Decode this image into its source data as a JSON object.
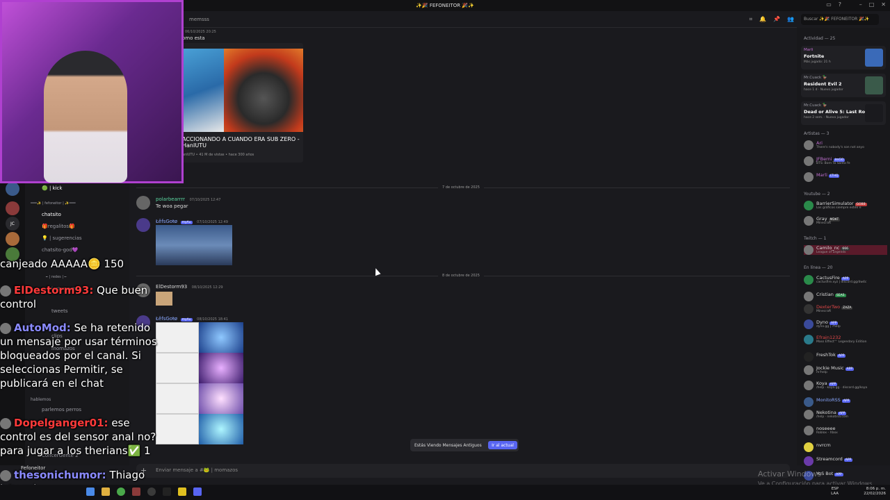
{
  "window": {
    "title": "✨🎉 FEFONEITOR 🎉✨"
  },
  "topbar": {
    "channel": "memsss",
    "search_placeholder": "Buscar ✨🎉 FEFONEITOR 🎉✨"
  },
  "messages": {
    "m0": {
      "time": "06/10/2025 20:25",
      "text": "omo esta"
    },
    "embed": {
      "title": "ACCIONANDO A CUANDO ERA SUB ZERO - HanIUTU",
      "sub": "anIUTU • 41 M de vistas • hace 300 años"
    },
    "div1": "7 de octubre de 2025",
    "m1": {
      "author": "polarbearrrr",
      "time": "07/10/2025 12:47",
      "text": "Te woa pegar"
    },
    "m2": {
      "author": "ŁêfsGoŧø",
      "badge": "myAu",
      "time": "07/10/2025 12:49"
    },
    "div2": "8 de octubre de 2025",
    "m3": {
      "author": "ElDestorm93",
      "time": "08/10/2025 12:29"
    },
    "m4": {
      "author": "ŁêfsGoŧø",
      "badge": "myAu",
      "time": "08/10/2025 18:41"
    }
  },
  "older_bar": {
    "text": "Estás Viendo Mensajes Antiguos",
    "button": "Ir al actual"
  },
  "composer": {
    "placeholder": "Enviar mensaje a #🐸 | momazos"
  },
  "channels": {
    "c1": "🟢 | kick",
    "c2": "═══✨ | fefoneitor | ✨═══",
    "c3": "chatsito",
    "c4": "🎁regalitos🎁",
    "c5": "💡 | sugerencias",
    "c6": "chatsito-god💜",
    "c7": "╾ | redes | ╾",
    "c8": "instagram",
    "c9": "tweets",
    "c10": "clips",
    "c11": "momazos",
    "c12": "hablemos",
    "c13": "parlemos perros",
    "c14": "ConcerGente 2",
    "user": "Fefoneitor"
  },
  "members": {
    "activity_header": "Actividad — 25",
    "act1": {
      "name": "Marli",
      "game": "Fortnite",
      "sub": "Más jugado: 21 h"
    },
    "act2": {
      "name": "Mr.Cuack 🦆",
      "game": "Resident Evil 2",
      "sub": "hace 1 d · Nuevo jugador"
    },
    "act3": {
      "name": "Mr.Cuack 🦆",
      "game": "Dead or Alive 5: Last Round",
      "sub": "hace 2 sem. · Nuevo jugador"
    },
    "artists_header": "Artistas — 3",
    "a1": {
      "name": "Ari",
      "sub": "There's nobody's son not anyo"
    },
    "a2": {
      "name": "JFBerni",
      "tag": "ImGO",
      "sub": "BTS: Born To Santa fe"
    },
    "a3": {
      "name": "Marli",
      "tag": "LTHQ"
    },
    "yt_header": "Youtube — 2",
    "y1": {
      "name": "BarrierSimulator",
      "tag": "GOBB",
      "sub": "Los gráficos siempre estén e"
    },
    "y2": {
      "name": "Gray",
      "tag": "MDKT",
      "sub": "Minecraft"
    },
    "tw_header": "Twitch — 1",
    "t1": {
      "name": "Camilo_nc",
      "tag": "666",
      "sub": "League of Legends"
    },
    "online_header": "En línea — 20",
    "o1": {
      "name": "CactusFire",
      "tag": "APP",
      "sub": "cactusfire.xyz | discord.gg/dw4c"
    },
    "o2": {
      "name": "Cristian",
      "tag": "SEAS"
    },
    "o3": {
      "name": "DexterTwo",
      "tag": "ZAZA",
      "sub": "Minecraft"
    },
    "o4": {
      "name": "Dyno",
      "tag": "APP",
      "sub": "dyno.gg | ?help"
    },
    "o5": {
      "name": "Efrain1232",
      "sub": "Mass Effect™ Legendary Edition"
    },
    "o6": {
      "name": "FreshTok",
      "tag": "APP"
    },
    "o7": {
      "name": "Jockie Music",
      "tag": "APP",
      "sub": "m!help"
    },
    "o8": {
      "name": "Koya",
      "tag": "APP",
      "sub": "/help · koya.gg · discord.gg/koya"
    },
    "o9": {
      "name": "MonitoRSS",
      "tag": "APP"
    },
    "o10": {
      "name": "Nekotina",
      "tag": "APP",
      "sub": "/help · nekotina.com"
    },
    "o11": {
      "name": "noseeee",
      "sub": "Roblox - Xbox"
    },
    "o12": {
      "name": "nvrcrn"
    },
    "o13": {
      "name": "Streamcord",
      "tag": "APP"
    },
    "o14": {
      "name": "YoS Bot",
      "tag": "APP"
    }
  },
  "overlay_chat": {
    "l1": "canjeado AAAAA🪙 150",
    "u2": "ElDestorm93:",
    "t2": "Que buen control",
    "u3": "AutoMod:",
    "t3": "Se ha retenido un mensaje por usar términos bloqueados por el canal. Si seleccionas Permitir, se publicará en el chat",
    "u4": "Dopelganger01:",
    "t4": "ese control es del sensor anal no? para jugar a los therians✅ 1",
    "u5": "thesonichumor:",
    "t5": "Thiago iutu xd"
  },
  "watermark": {
    "line1": "Activar Windows",
    "line2": "Ve a Configuración para activar Windows."
  },
  "tray": {
    "lang": "ESP",
    "lang2": "LAA",
    "time": "8:06 p. m.",
    "date": "22/02/2026"
  },
  "colors": {
    "accent": "#5865f2",
    "online": "#23a55a",
    "webcam_border": "#b040d0"
  }
}
